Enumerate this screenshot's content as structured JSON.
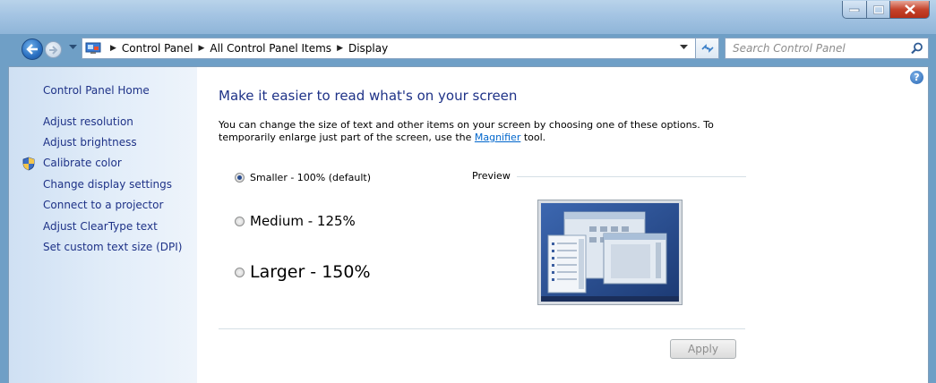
{
  "address": {
    "crumbs": [
      "Control Panel",
      "All Control Panel Items",
      "Display"
    ]
  },
  "search": {
    "placeholder": "Search Control Panel"
  },
  "sidebar": {
    "home": "Control Panel Home",
    "links": [
      "Adjust resolution",
      "Adjust brightness",
      "Calibrate color",
      "Change display settings",
      "Connect to a projector",
      "Adjust ClearType text",
      "Set custom text size (DPI)"
    ]
  },
  "main": {
    "heading": "Make it easier to read what's on your screen",
    "desc_line1": "You can change the size of text and other items on your screen by choosing one of these options. To",
    "desc_line2_pre": "temporarily enlarge just part of the screen, use the",
    "desc_link": "Magnifier",
    "desc_line2_post": "tool.",
    "options": [
      {
        "label": "Smaller - 100% (default)",
        "checked": true
      },
      {
        "label": "Medium - 125%",
        "checked": false
      },
      {
        "label": "Larger - 150%",
        "checked": false
      }
    ],
    "selected_option": "Smaller - 100% (default)",
    "preview_label": "Preview",
    "apply_label": "Apply"
  },
  "colors": {
    "link": "#1e3287",
    "accent_link": "#0066cc",
    "frame": "#6f9fc6"
  }
}
